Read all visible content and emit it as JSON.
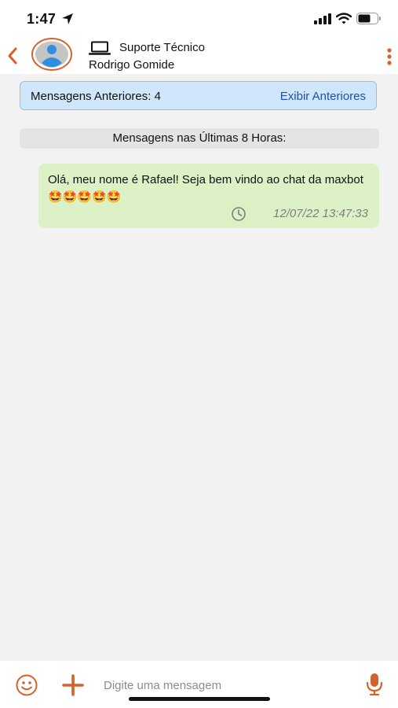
{
  "status_bar": {
    "time": "1:47",
    "icons": [
      "location-arrow-icon",
      "cellular-signal-icon",
      "wifi-icon",
      "battery-icon"
    ]
  },
  "header": {
    "department": "Suporte Técnico",
    "agent_name": "Rodrigo Gomide",
    "icons": {
      "back": "chevron-left-icon",
      "avatar": "user-avatar-icon",
      "department": "laptop-icon",
      "menu": "more-vertical-icon"
    }
  },
  "previous_messages": {
    "label": "Mensagens Anteriores: 4",
    "action": "Exibir Anteriores"
  },
  "section_header": "Mensagens nas Últimas 8 Horas:",
  "messages": [
    {
      "text": "Olá, meu nome é Rafael! Seja bem vindo ao chat da maxbot 🤩🤩🤩🤩🤩",
      "timestamp": "12/07/22 13:47:33"
    }
  ],
  "composer": {
    "placeholder": "Digite uma mensagem",
    "icons": [
      "emoji-icon",
      "plus-icon",
      "microphone-icon"
    ]
  },
  "colors": {
    "accent": "#d4622a",
    "link": "#1d4fb8",
    "bubble": "#dcf2c6",
    "info_bar": "#cfe6fb",
    "background": "#f2f2f2"
  }
}
